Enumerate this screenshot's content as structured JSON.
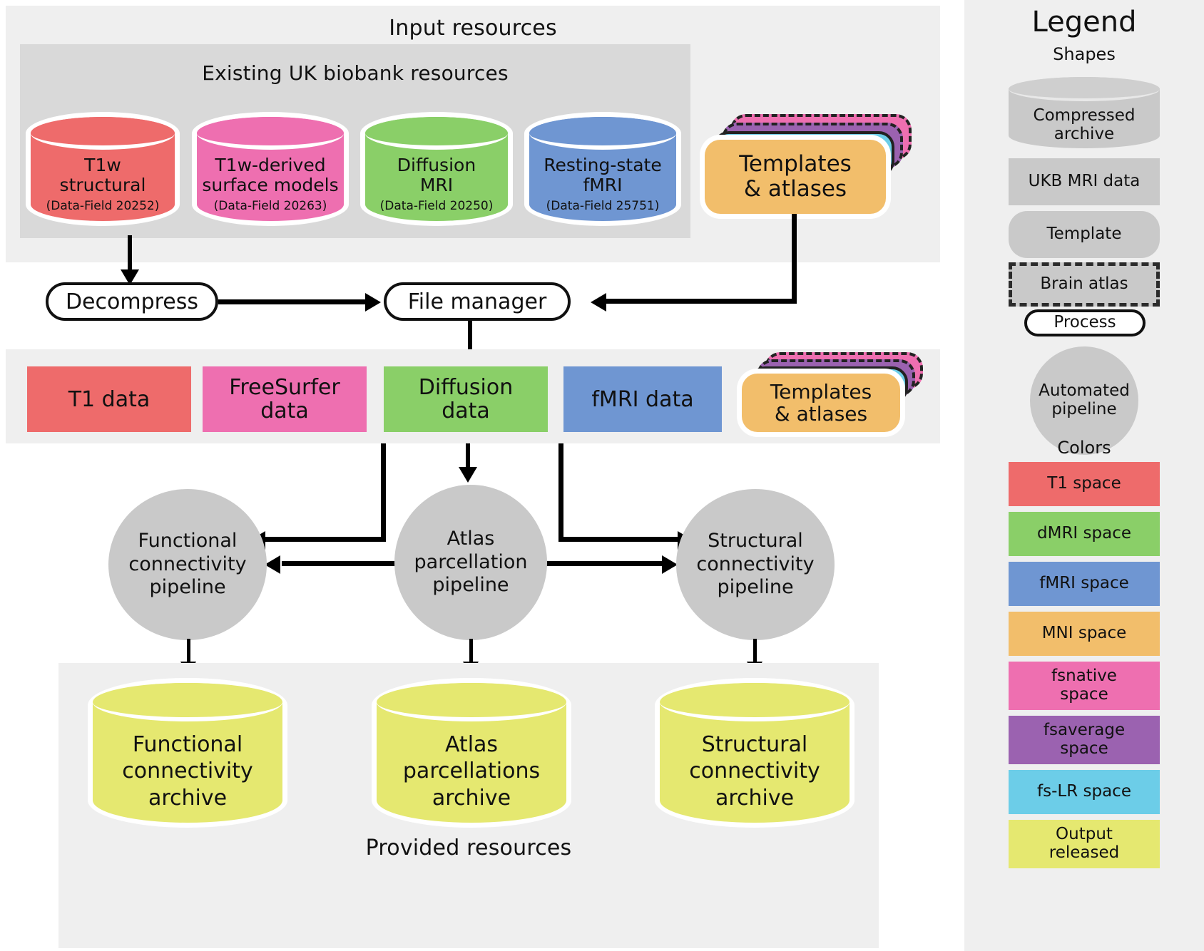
{
  "sections": {
    "input": {
      "title": "Input resources",
      "inner_title": "Existing UK biobank resources"
    },
    "provided": {
      "title": "Provided resources"
    }
  },
  "ukb_cylinders": [
    {
      "name": "t1w-structural",
      "main": "T1w\nstructural",
      "sub": "(Data-Field 20252)",
      "color": "#EE6B6B"
    },
    {
      "name": "t1w-derived-surface",
      "main": "T1w-derived\nsurface models",
      "sub": "(Data-Field 20263)",
      "color": "#EE6FB0"
    },
    {
      "name": "diffusion-mri",
      "main": "Diffusion\nMRI",
      "sub": "(Data-Field 20250)",
      "color": "#8ACF68"
    },
    {
      "name": "resting-state-fmri",
      "main": "Resting-state\nfMRI",
      "sub": "(Data-Field 25751)",
      "color": "#6F96D2"
    }
  ],
  "templates_top": {
    "line1": "Templates",
    "line2": "& atlases"
  },
  "templates_mid": {
    "line1": "Templates",
    "line2": "& atlases"
  },
  "stack_colors": {
    "front": "#F2BE6B",
    "l1": "#6CCDE8",
    "l2": "#9B62B0",
    "l3": "#EE6FB0"
  },
  "processes": {
    "decompress": "Decompress",
    "file_manager": "File manager"
  },
  "data_boxes": [
    {
      "name": "t1-data",
      "label": "T1 data",
      "color": "#EE6B6B"
    },
    {
      "name": "freesurfer-data",
      "label": "FreeSurfer\ndata",
      "color": "#EE6FB0"
    },
    {
      "name": "diffusion-data",
      "label": "Diffusion\ndata",
      "color": "#8ACF68"
    },
    {
      "name": "fmri-data",
      "label": "fMRI data",
      "color": "#6F96D2"
    }
  ],
  "pipelines": [
    {
      "name": "functional-connectivity-pipeline",
      "label": "Functional\nconnectivity\npipeline"
    },
    {
      "name": "atlas-parcellation-pipeline",
      "label": "Atlas\nparcellation\npipeline"
    },
    {
      "name": "structural-connectivity-pipeline",
      "label": "Structural\nconnectivity\npipeline"
    }
  ],
  "archives": [
    {
      "name": "functional-connectivity-archive",
      "label": "Functional\nconnectivity\narchive",
      "color": "#E5E870"
    },
    {
      "name": "atlas-parcellations-archive",
      "label": "Atlas\nparcellations\narchive",
      "color": "#E5E870"
    },
    {
      "name": "structural-connectivity-archive",
      "label": "Structural\nconnectivity\narchive",
      "color": "#E5E870"
    }
  ],
  "legend": {
    "title": "Legend",
    "shapes_heading": "Shapes",
    "colors_heading": "Colors",
    "shapes": [
      {
        "name": "compressed-archive",
        "label": "Compressed\narchive"
      },
      {
        "name": "ukb-mri-data",
        "label": "UKB MRI data"
      },
      {
        "name": "template",
        "label": "Template"
      },
      {
        "name": "brain-atlas",
        "label": "Brain atlas"
      },
      {
        "name": "process",
        "label": "Process"
      },
      {
        "name": "automated-pipeline",
        "label": "Automated\npipeline"
      }
    ],
    "colors": [
      {
        "name": "t1-space",
        "label": "T1 space",
        "color": "#EE6B6B"
      },
      {
        "name": "dmri-space",
        "label": "dMRI space",
        "color": "#8ACF68"
      },
      {
        "name": "fmri-space",
        "label": "fMRI space",
        "color": "#6F96D2"
      },
      {
        "name": "mni-space",
        "label": "MNI space",
        "color": "#F2BE6B"
      },
      {
        "name": "fsnative-space",
        "label": "fsnative\nspace",
        "color": "#EE6FB0"
      },
      {
        "name": "fsaverage-space",
        "label": "fsaverage\nspace",
        "color": "#9B62B0"
      },
      {
        "name": "fs-lr-space",
        "label": "fs-LR space",
        "color": "#6CCDE8"
      },
      {
        "name": "output-released",
        "label": "Output\nreleased",
        "color": "#E5E870"
      }
    ]
  }
}
